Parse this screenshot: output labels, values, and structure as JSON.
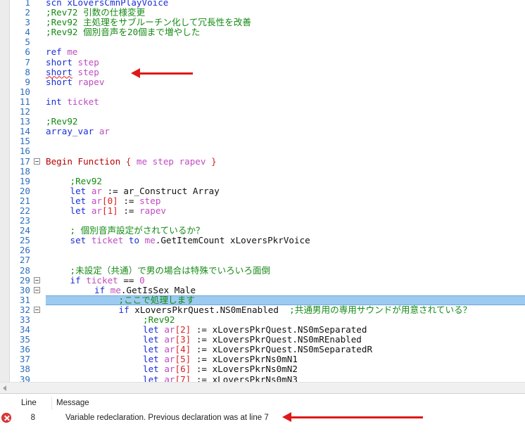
{
  "editor": {
    "fold_lines": [
      17,
      29,
      30,
      32
    ],
    "highlight_line": 31,
    "lines": [
      {
        "n": "1",
        "indent": 0,
        "tokens": [
          {
            "t": "scn",
            "c": "kw"
          },
          {
            "t": " xLoversCmnPlayVoice",
            "c": "kw"
          }
        ]
      },
      {
        "n": "2",
        "indent": 0,
        "tokens": [
          {
            "t": ";Rev72 引数の仕様変更",
            "c": "cm"
          }
        ]
      },
      {
        "n": "3",
        "indent": 0,
        "tokens": [
          {
            "t": ";Rev92 主処理をサブルーチン化して冗長性を改善",
            "c": "cm"
          }
        ]
      },
      {
        "n": "4",
        "indent": 0,
        "tokens": [
          {
            "t": ";Rev92 個別音声を20個まで増やした",
            "c": "cm"
          }
        ]
      },
      {
        "n": "5",
        "indent": 0,
        "tokens": []
      },
      {
        "n": "6",
        "indent": 0,
        "tokens": [
          {
            "t": "ref",
            "c": "kw"
          },
          {
            "t": " me",
            "c": "id"
          }
        ]
      },
      {
        "n": "7",
        "indent": 0,
        "tokens": [
          {
            "t": "short",
            "c": "kw"
          },
          {
            "t": " step",
            "c": "id"
          }
        ]
      },
      {
        "n": "8",
        "indent": 0,
        "tokens": [
          {
            "t": "short",
            "c": "err"
          },
          {
            "t": " step",
            "c": "id"
          }
        ]
      },
      {
        "n": "9",
        "indent": 0,
        "tokens": [
          {
            "t": "short",
            "c": "kw"
          },
          {
            "t": " rapev",
            "c": "id"
          }
        ]
      },
      {
        "n": "10",
        "indent": 0,
        "tokens": []
      },
      {
        "n": "11",
        "indent": 0,
        "tokens": [
          {
            "t": "int",
            "c": "kw"
          },
          {
            "t": " ticket",
            "c": "id"
          }
        ]
      },
      {
        "n": "12",
        "indent": 0,
        "tokens": []
      },
      {
        "n": "13",
        "indent": 0,
        "tokens": [
          {
            "t": ";Rev92",
            "c": "cm"
          }
        ]
      },
      {
        "n": "14",
        "indent": 0,
        "tokens": [
          {
            "t": "array_var",
            "c": "kw"
          },
          {
            "t": " ar",
            "c": "id"
          }
        ]
      },
      {
        "n": "15",
        "indent": 0,
        "tokens": []
      },
      {
        "n": "16",
        "indent": 0,
        "tokens": []
      },
      {
        "n": "17",
        "indent": 0,
        "tokens": [
          {
            "t": "Begin Function",
            "c": "fn"
          },
          {
            "t": " { ",
            "c": "op"
          },
          {
            "t": "me step rapev",
            "c": "id"
          },
          {
            "t": " }",
            "c": "op"
          }
        ]
      },
      {
        "n": "18",
        "indent": 0,
        "tokens": []
      },
      {
        "n": "19",
        "indent": 1,
        "tokens": [
          {
            "t": ";Rev92",
            "c": "cm"
          }
        ]
      },
      {
        "n": "20",
        "indent": 1,
        "tokens": [
          {
            "t": "let",
            "c": "kw"
          },
          {
            "t": " ar",
            "c": "id"
          },
          {
            "t": " := ",
            "c": "df"
          },
          {
            "t": "ar_Construct Array",
            "c": "df"
          }
        ]
      },
      {
        "n": "21",
        "indent": 1,
        "tokens": [
          {
            "t": "let",
            "c": "kw"
          },
          {
            "t": " ar",
            "c": "id"
          },
          {
            "t": "[0]",
            "c": "op"
          },
          {
            "t": " := ",
            "c": "df"
          },
          {
            "t": "step",
            "c": "id"
          }
        ]
      },
      {
        "n": "22",
        "indent": 1,
        "tokens": [
          {
            "t": "let",
            "c": "kw"
          },
          {
            "t": " ar",
            "c": "id"
          },
          {
            "t": "[1]",
            "c": "op"
          },
          {
            "t": " := ",
            "c": "df"
          },
          {
            "t": "rapev",
            "c": "id"
          }
        ]
      },
      {
        "n": "23",
        "indent": 0,
        "tokens": []
      },
      {
        "n": "24",
        "indent": 1,
        "tokens": [
          {
            "t": "; 個別音声設定がされているか？",
            "c": "cm"
          }
        ]
      },
      {
        "n": "25",
        "indent": 1,
        "tokens": [
          {
            "t": "set",
            "c": "kw"
          },
          {
            "t": " ticket",
            "c": "id"
          },
          {
            "t": " to ",
            "c": "kw"
          },
          {
            "t": "me",
            "c": "id"
          },
          {
            "t": ".GetItemCount xLoversPkrVoice",
            "c": "df"
          }
        ]
      },
      {
        "n": "26",
        "indent": 0,
        "tokens": []
      },
      {
        "n": "27",
        "indent": 0,
        "tokens": []
      },
      {
        "n": "28",
        "indent": 1,
        "tokens": [
          {
            "t": ";未設定（共通）で男の場合は特殊でいろいろ面倒",
            "c": "cm"
          }
        ]
      },
      {
        "n": "29",
        "indent": 1,
        "tokens": [
          {
            "t": "if",
            "c": "kw"
          },
          {
            "t": " ticket",
            "c": "id"
          },
          {
            "t": " == ",
            "c": "df"
          },
          {
            "t": "0",
            "c": "id"
          }
        ]
      },
      {
        "n": "30",
        "indent": 2,
        "tokens": [
          {
            "t": "if",
            "c": "kw"
          },
          {
            "t": " me",
            "c": "id"
          },
          {
            "t": ".GetIsSex Male",
            "c": "df"
          }
        ]
      },
      {
        "n": "31",
        "indent": 3,
        "tokens": [
          {
            "t": ";ここで処理します",
            "c": "cm"
          }
        ]
      },
      {
        "n": "32",
        "indent": 3,
        "tokens": [
          {
            "t": "if",
            "c": "kw"
          },
          {
            "t": " xLoversPkrQuest.NS0mEnabled",
            "c": "df"
          },
          {
            "t": "  ;共通男用の専用サウンドが用意されている？",
            "c": "cm"
          }
        ]
      },
      {
        "n": "33",
        "indent": 4,
        "tokens": [
          {
            "t": ";Rev92",
            "c": "cm"
          }
        ]
      },
      {
        "n": "34",
        "indent": 4,
        "tokens": [
          {
            "t": "let",
            "c": "kw"
          },
          {
            "t": " ar",
            "c": "id"
          },
          {
            "t": "[2]",
            "c": "op"
          },
          {
            "t": " := ",
            "c": "df"
          },
          {
            "t": "xLoversPkrQuest.NS0mSeparated",
            "c": "df"
          }
        ]
      },
      {
        "n": "35",
        "indent": 4,
        "tokens": [
          {
            "t": "let",
            "c": "kw"
          },
          {
            "t": " ar",
            "c": "id"
          },
          {
            "t": "[3]",
            "c": "op"
          },
          {
            "t": " := ",
            "c": "df"
          },
          {
            "t": "xLoversPkrQuest.NS0mREnabled",
            "c": "df"
          }
        ]
      },
      {
        "n": "36",
        "indent": 4,
        "tokens": [
          {
            "t": "let",
            "c": "kw"
          },
          {
            "t": " ar",
            "c": "id"
          },
          {
            "t": "[4]",
            "c": "op"
          },
          {
            "t": " := ",
            "c": "df"
          },
          {
            "t": "xLoversPkrQuest.NS0mSeparatedR",
            "c": "df"
          }
        ]
      },
      {
        "n": "37",
        "indent": 4,
        "tokens": [
          {
            "t": "let",
            "c": "kw"
          },
          {
            "t": " ar",
            "c": "id"
          },
          {
            "t": "[5]",
            "c": "op"
          },
          {
            "t": " := ",
            "c": "df"
          },
          {
            "t": "xLoversPkrNs0mN1",
            "c": "df"
          }
        ]
      },
      {
        "n": "38",
        "indent": 4,
        "tokens": [
          {
            "t": "let",
            "c": "kw"
          },
          {
            "t": " ar",
            "c": "id"
          },
          {
            "t": "[6]",
            "c": "op"
          },
          {
            "t": " := ",
            "c": "df"
          },
          {
            "t": "xLoversPkrNs0mN2",
            "c": "df"
          }
        ]
      },
      {
        "n": "39",
        "indent": 4,
        "tokens": [
          {
            "t": "let",
            "c": "kw"
          },
          {
            "t": " ar",
            "c": "id"
          },
          {
            "t": "[7]",
            "c": "op"
          },
          {
            "t": " := ",
            "c": "df"
          },
          {
            "t": "xLoversPkrNs0mN3",
            "c": "df"
          }
        ]
      }
    ]
  },
  "error_list": {
    "columns": {
      "line": "Line",
      "message": "Message"
    },
    "rows": [
      {
        "line": "8",
        "message": "Variable redeclaration. Previous declaration was at line 7",
        "icon": "error-icon"
      }
    ]
  },
  "colors": {
    "highlight": "#9ccaf0",
    "annotation_arrow": "#e01818"
  }
}
